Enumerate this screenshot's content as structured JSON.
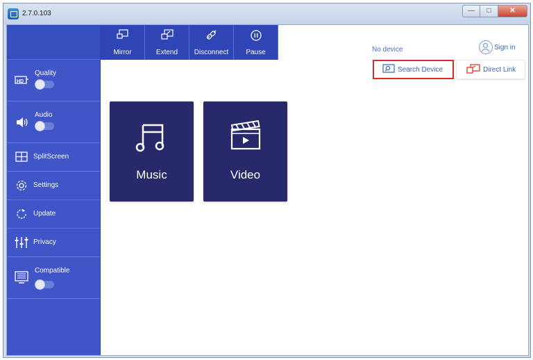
{
  "window": {
    "title": "2.7.0.103"
  },
  "toolbar": {
    "buttons": [
      {
        "label": "Mirror",
        "icon": "mirror-icon"
      },
      {
        "label": "Extend",
        "icon": "extend-icon"
      },
      {
        "label": "Disconnect",
        "icon": "disconnect-icon"
      },
      {
        "label": "Pause",
        "icon": "pause-icon"
      }
    ]
  },
  "sidebar": {
    "items": [
      {
        "label": "Quality",
        "icon": "hd-icon",
        "toggle": false
      },
      {
        "label": "Audio",
        "icon": "speaker-icon",
        "toggle": false
      },
      {
        "label": "SplitScreen",
        "icon": "splitscreen-icon"
      },
      {
        "label": "Settings",
        "icon": "gear-icon"
      },
      {
        "label": "Update",
        "icon": "refresh-icon"
      },
      {
        "label": "Privacy",
        "icon": "sliders-icon"
      },
      {
        "label": "Compatible",
        "icon": "monitor-icon",
        "toggle": false
      }
    ]
  },
  "status": {
    "text": "No device"
  },
  "account": {
    "signin_label": "Sign in"
  },
  "actions": {
    "search_label": "Search Device",
    "direct_label": "Direct Link"
  },
  "tiles": [
    {
      "label": "Music",
      "icon": "music-note-icon"
    },
    {
      "label": "Video",
      "icon": "clapperboard-icon"
    }
  ],
  "colors": {
    "sidebar_bg": "#3f55c8",
    "toolbar_bg": "#2f45b6",
    "tile_bg": "#28296a",
    "highlight": "#dc2a2a",
    "link_text": "#3567b8"
  }
}
